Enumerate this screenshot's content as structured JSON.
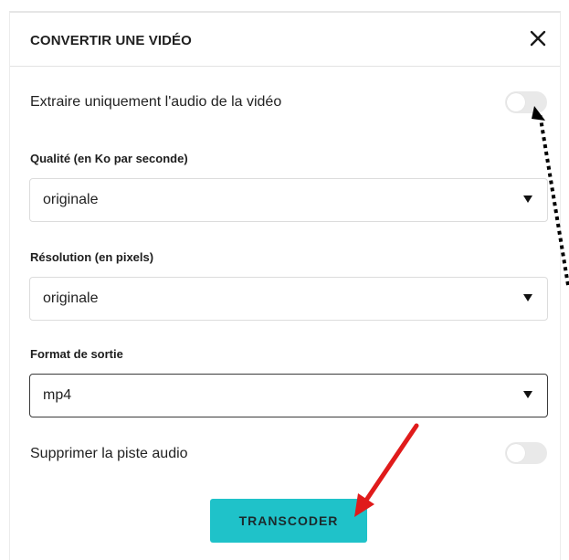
{
  "dialog": {
    "title": "CONVERTIR UNE VIDÉO",
    "close_icon": "close-icon",
    "extract_audio_label": "Extraire uniquement l'audio de la vidéo",
    "extract_audio_on": false,
    "quality": {
      "label": "Qualité (en Ko par seconde)",
      "value": "originale"
    },
    "resolution": {
      "label": "Résolution (en pixels)",
      "value": "originale"
    },
    "format": {
      "label": "Format de sortie",
      "value": "mp4"
    },
    "remove_audio_label": "Supprimer la piste audio",
    "remove_audio_on": false,
    "submit_label": "TRANSCODER"
  },
  "colors": {
    "button": "#1fc2c9",
    "arrow_red": "#e01b1b",
    "toggle_off": "#e9e9e9"
  }
}
